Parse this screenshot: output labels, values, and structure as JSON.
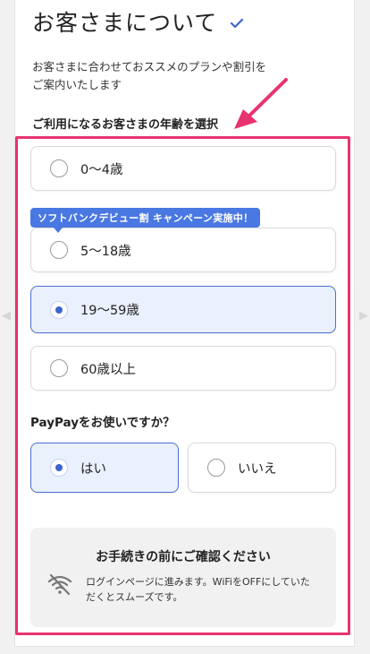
{
  "header": {
    "title": "お客さまについて"
  },
  "intro": {
    "line1": "お客さまに合わせておススメのプランや割引を",
    "line2": "ご案内いたします"
  },
  "age_section": {
    "heading": "ご利用になるお客さまの年齢を選択",
    "badge": "ソフトバンクデビュー割 キャンペーン実施中！",
    "options": [
      {
        "label": "0〜4歳",
        "selected": false
      },
      {
        "label": "5〜18歳",
        "selected": false
      },
      {
        "label": "19〜59歳",
        "selected": true
      },
      {
        "label": "60歳以上",
        "selected": false
      }
    ]
  },
  "paypay_section": {
    "heading": "PayPayをお使いですか？",
    "options": [
      {
        "label": "はい",
        "selected": true
      },
      {
        "label": "いいえ",
        "selected": false
      }
    ]
  },
  "notice": {
    "title": "お手続きの前にご確認ください",
    "line1": "ログインページに進みます。WiFiをOFFにしていた",
    "line2": "だくとスムーズです。"
  },
  "colors": {
    "highlight": "#e8336f",
    "accent_blue": "#3b63d1",
    "selected_bg": "#eaf0fc",
    "badge_bg": "#4a78e2"
  }
}
